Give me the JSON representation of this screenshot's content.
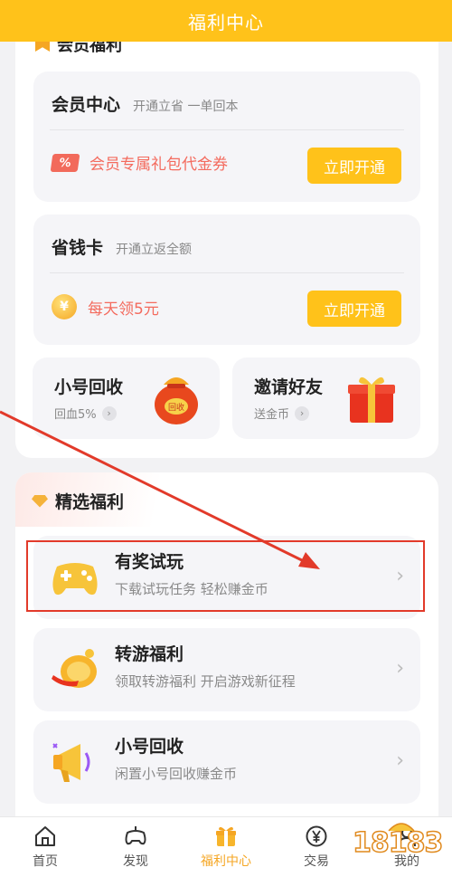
{
  "header": {
    "title": "福利中心"
  },
  "benefits_card": {
    "partial_title": "会员福利",
    "member": {
      "title": "会员中心",
      "subtitle": "开通立省 一单回本",
      "coupon_icon_text": "%",
      "perk": "会员专属礼包代金券",
      "button": "立即开通"
    },
    "saver": {
      "title": "省钱卡",
      "subtitle": "开通立返全额",
      "coin_icon_text": "¥",
      "perk": "每天领5元",
      "button": "立即开通"
    },
    "mini_cards": [
      {
        "title": "小号回收",
        "subtitle": "回血5%",
        "icon": "money-bag-icon",
        "icon_text": "回收"
      },
      {
        "title": "邀请好友",
        "subtitle": "送金币",
        "icon": "gift-box-icon"
      }
    ]
  },
  "featured": {
    "title": "精选福利",
    "rows": [
      {
        "title": "有奖试玩",
        "subtitle": "下载试玩任务 轻松赚金币",
        "icon": "gamepad-icon"
      },
      {
        "title": "转游福利",
        "subtitle": "领取转游福利 开启游戏新征程",
        "icon": "coin-swap-icon"
      },
      {
        "title": "小号回收",
        "subtitle": "闲置小号回收赚金币",
        "icon": "megaphone-icon"
      }
    ]
  },
  "tabbar": {
    "items": [
      {
        "label": "首页",
        "icon": "home-icon"
      },
      {
        "label": "发现",
        "icon": "gamepad-outline-icon"
      },
      {
        "label": "福利中心",
        "icon": "gift-icon",
        "active": true
      },
      {
        "label": "交易",
        "icon": "yen-icon"
      },
      {
        "label": "我的",
        "icon": "user-icon"
      }
    ]
  },
  "watermark": {
    "text": "18183"
  },
  "colors": {
    "accent": "#ffc21a",
    "perk_text": "#f46b5e",
    "annotation": "#e23a2a"
  }
}
